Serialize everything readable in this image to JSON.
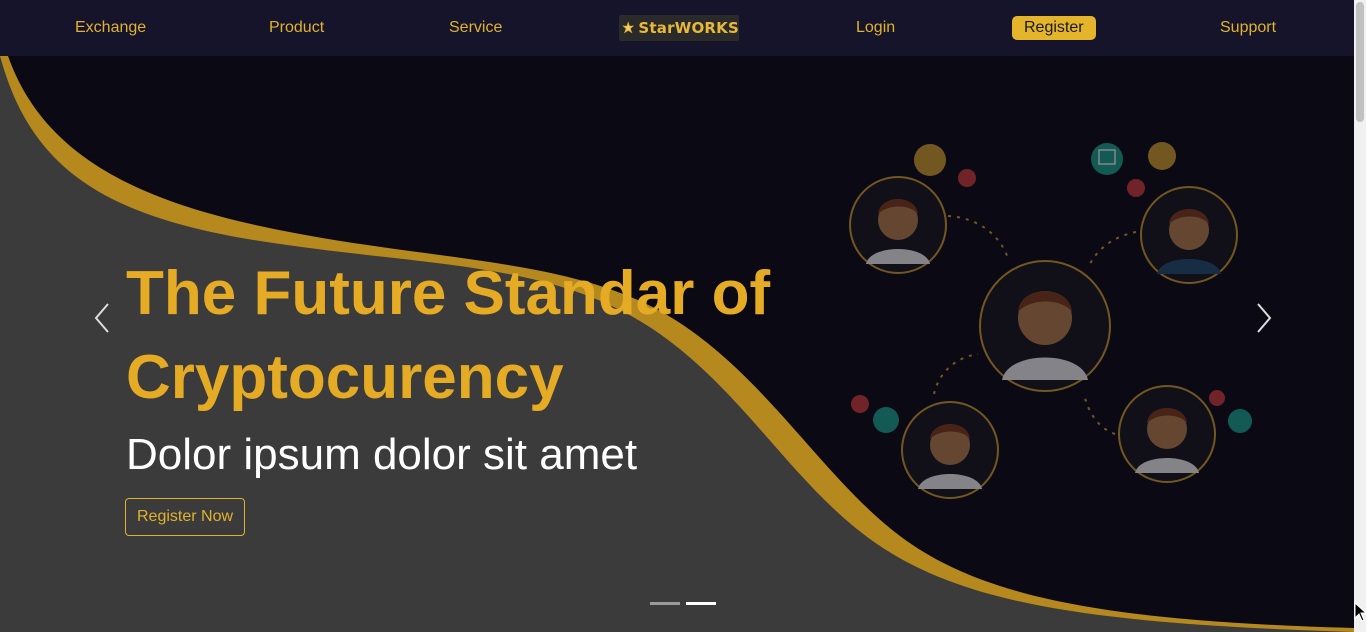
{
  "nav": {
    "items": [
      {
        "label": "Exchange"
      },
      {
        "label": "Product"
      },
      {
        "label": "Service"
      },
      {
        "label": "Login"
      },
      {
        "label": "Register"
      },
      {
        "label": "Support"
      }
    ],
    "logo_text": "StarWORKS"
  },
  "hero": {
    "title": "The Future Standar of Cryptocurency",
    "subtitle": "Dolor ipsum dolor sit amet",
    "cta_label": "Register Now",
    "prev_icon": "chevron-left-icon",
    "next_icon": "chevron-right-icon",
    "slides_count": 2,
    "active_slide": 2
  },
  "colors": {
    "nav_bg": "#15142a",
    "accent": "#e4b42a",
    "hero_dark": "#0b0a14",
    "hero_grey": "#3a3a3a"
  }
}
